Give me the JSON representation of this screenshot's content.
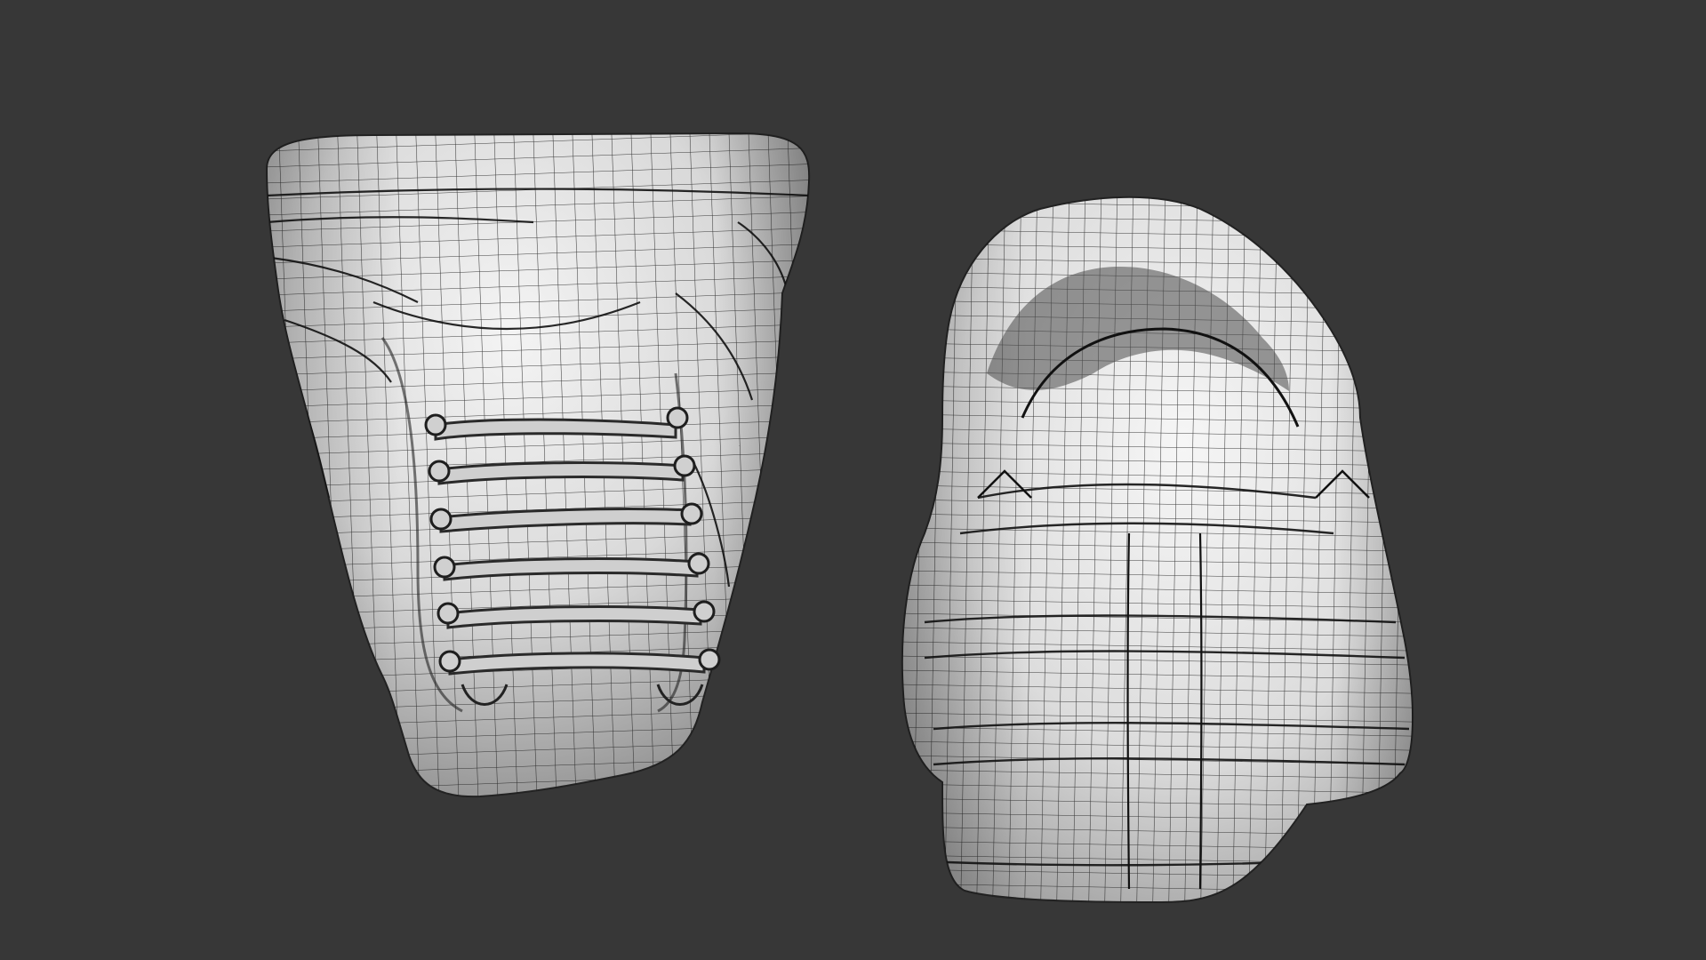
{
  "viewport": {
    "background": "#373737",
    "objects": [
      {
        "id": "shoe-front",
        "view": "front",
        "laces": true,
        "shading": "clay-wireframe"
      },
      {
        "id": "shoe-back",
        "view": "back",
        "laces": false,
        "shading": "clay-wireframe"
      }
    ],
    "colors": {
      "clay_base": "#d8d8d8",
      "clay_light": "#f2f2f2",
      "clay_shadow": "#9a9a9a",
      "wire": "#1c1c1c"
    }
  }
}
